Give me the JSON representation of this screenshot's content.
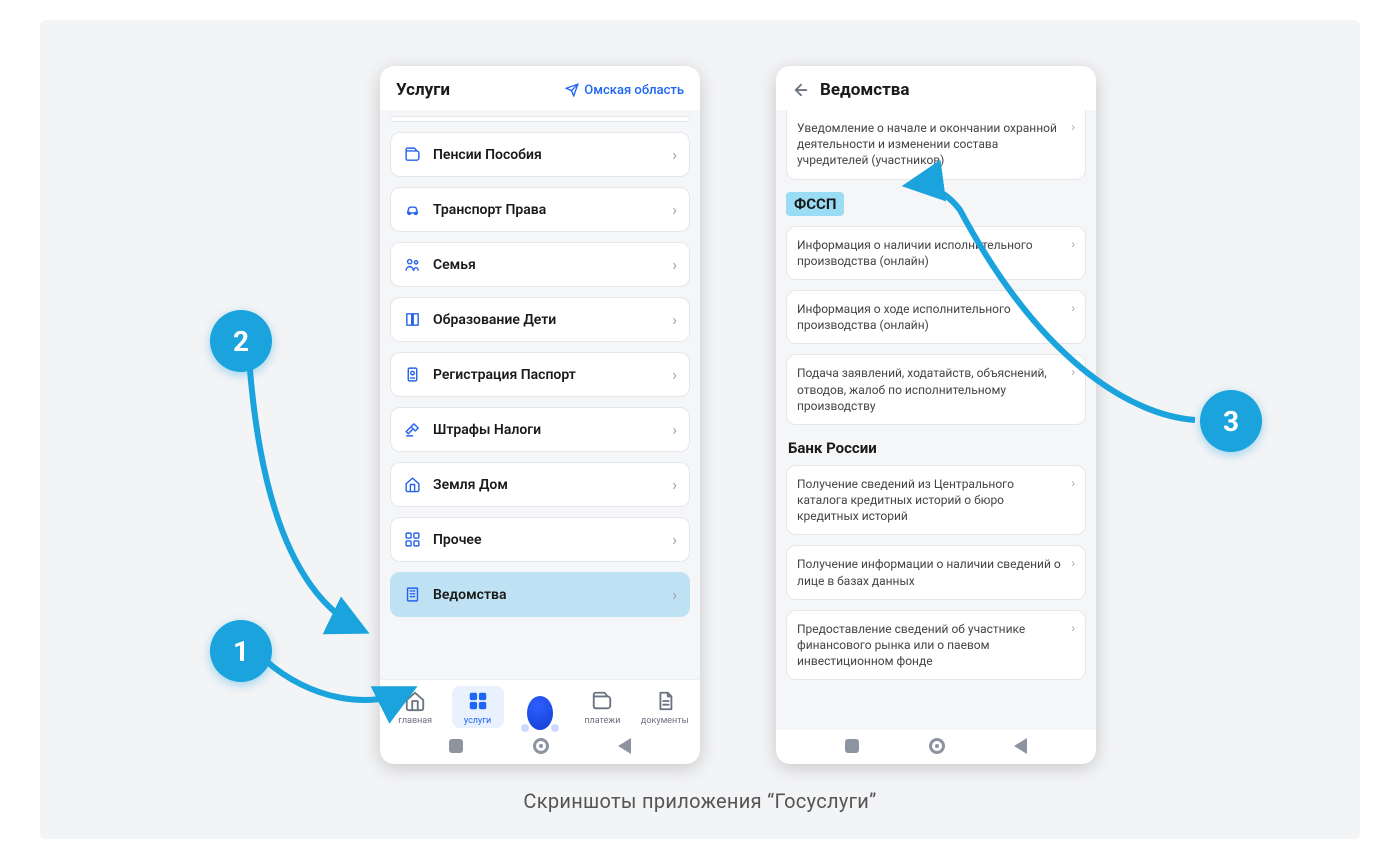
{
  "caption": "Скриншоты приложения “Госуслуги”",
  "badges": {
    "b1": "1",
    "b2": "2",
    "b3": "3"
  },
  "phone1": {
    "title": "Услуги",
    "region": "Омская область",
    "services": [
      {
        "label": "Пенсии Пособия",
        "icon": "wallet"
      },
      {
        "label": "Транспорт Права",
        "icon": "car"
      },
      {
        "label": "Семья",
        "icon": "family"
      },
      {
        "label": "Образование Дети",
        "icon": "book"
      },
      {
        "label": "Регистрация Паспорт",
        "icon": "passport"
      },
      {
        "label": "Штрафы Налоги",
        "icon": "gavel"
      },
      {
        "label": "Земля Дом",
        "icon": "home"
      },
      {
        "label": "Прочее",
        "icon": "grid"
      },
      {
        "label": "Ведомства",
        "icon": "building",
        "highlight": true
      }
    ],
    "nav": [
      {
        "label": "главная",
        "icon": "home"
      },
      {
        "label": "услуги",
        "icon": "grid",
        "active": true
      },
      {
        "label": "",
        "icon": "robot"
      },
      {
        "label": "платежи",
        "icon": "wallet"
      },
      {
        "label": "документы",
        "icon": "doc"
      }
    ]
  },
  "phone2": {
    "title": "Ведомства",
    "top_item": "Уведомление о начале и окончании охранной деятельности и изменении состава учредителей (участников)",
    "section1": "ФССП",
    "items1": [
      "Информация о наличии исполнительного производства (онлайн)",
      "Информация о ходе исполнительного производства (онлайн)",
      "Подача заявлений, ходатайств, объяснений, отводов, жалоб по исполнительному производству"
    ],
    "section2": "Банк России",
    "items2": [
      "Получение сведений из Центрального каталога кредитных историй о бюро кредитных историй",
      "Получение информации о наличии сведений о лице в базах данных",
      "Предоставление сведений об участнике финансового рынка или о паевом инвестиционном фонде"
    ]
  }
}
